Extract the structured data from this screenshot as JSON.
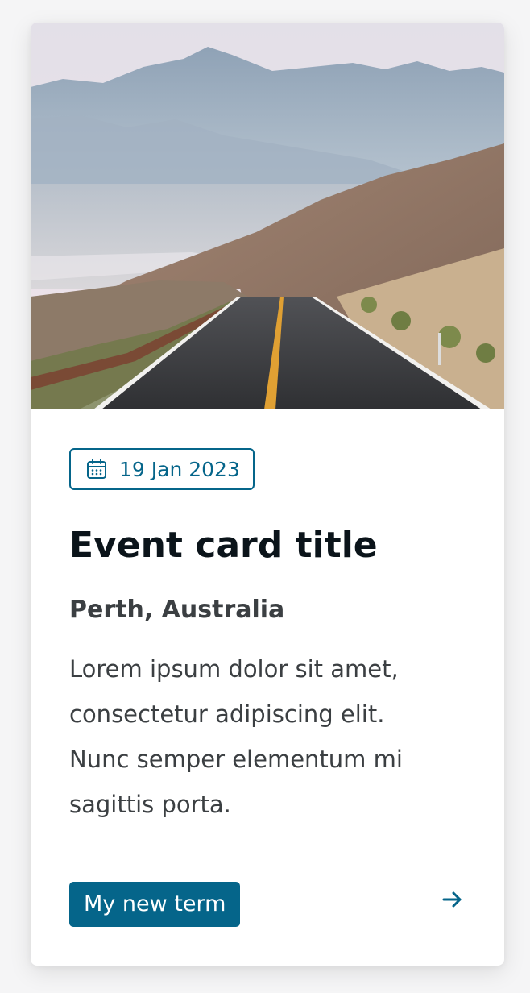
{
  "card": {
    "image": {
      "icon": "mountain-road-photo",
      "colors": {
        "sky": "#e6dbe2",
        "mountains": "#9fb0c1",
        "road": "#3a3b3d",
        "line": "#e0a033"
      }
    },
    "date": {
      "icon": "calendar-icon",
      "text": "19 Jan 2023"
    },
    "title": "Event card title",
    "location": "Perth, Australia",
    "description": "Lorem ipsum dolor sit amet, consectetur adipiscing elit. Nunc semper elementum mi sagittis porta.",
    "tag": {
      "label": "My new term"
    },
    "link": {
      "icon": "arrow-right-icon"
    },
    "colors": {
      "accent": "#05658a",
      "title": "#0b141a",
      "text": "#3b3f42"
    }
  }
}
